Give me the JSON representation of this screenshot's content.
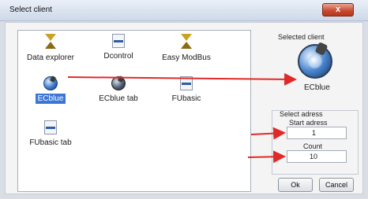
{
  "window": {
    "title": "Select client",
    "close_label": "x"
  },
  "clients": [
    {
      "label": "Data explorer",
      "icon": "sandclock-icon"
    },
    {
      "label": "Dcontrol",
      "icon": "panel-icon"
    },
    {
      "label": "Easy ModBus",
      "icon": "sandclock-icon"
    },
    {
      "label": "ECblue",
      "icon": "ecblue-icon",
      "selected": true
    },
    {
      "label": "ECblue tab",
      "icon": "ecblue-tab-icon"
    },
    {
      "label": "FUbasic",
      "icon": "panel-icon"
    },
    {
      "label": "FUbasic tab",
      "icon": "panel-icon"
    }
  ],
  "selected_client": {
    "heading": "Selected client",
    "name": "ECblue"
  },
  "address": {
    "heading": "Select adress",
    "start_label": "Start adress",
    "start_value": "1",
    "count_label": "Count",
    "count_value": "10"
  },
  "buttons": {
    "ok": "Ok",
    "cancel": "Cancel"
  },
  "colors": {
    "arrow": "#e02a2a",
    "selection": "#3a76d6",
    "titlebar": "#d6e0ee"
  }
}
